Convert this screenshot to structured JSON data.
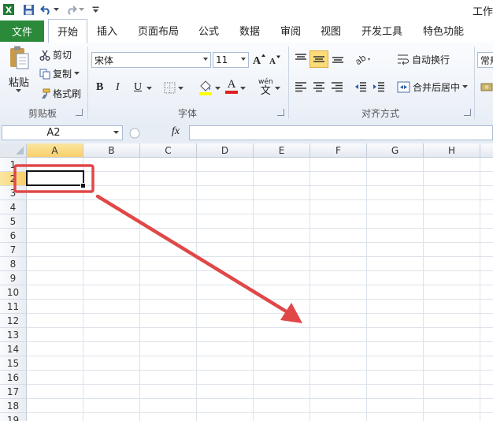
{
  "window": {
    "title": "工作"
  },
  "quick_access": {
    "icons": [
      "excel-logo-icon",
      "save-icon",
      "undo-icon",
      "redo-icon",
      "customize-qat-icon"
    ]
  },
  "tabs": [
    {
      "label": "文件",
      "active": false
    },
    {
      "label": "开始",
      "active": true
    },
    {
      "label": "插入",
      "active": false
    },
    {
      "label": "页面布局",
      "active": false
    },
    {
      "label": "公式",
      "active": false
    },
    {
      "label": "数据",
      "active": false
    },
    {
      "label": "审阅",
      "active": false
    },
    {
      "label": "视图",
      "active": false
    },
    {
      "label": "开发工具",
      "active": false
    },
    {
      "label": "特色功能",
      "active": false
    }
  ],
  "clipboard": {
    "paste": "粘贴",
    "cut": "剪切",
    "copy": "复制",
    "format_painter": "格式刷",
    "group": "剪贴板"
  },
  "font": {
    "name": "宋体",
    "size": "11",
    "bold": "B",
    "italic": "I",
    "underline": "U",
    "font_color_glyph": "A",
    "phonetic_top": "wén",
    "phonetic_bottom": "文",
    "group": "字体"
  },
  "alignment": {
    "wrap_text": "自动换行",
    "merge_center": "合并后居中",
    "group": "对齐方式"
  },
  "number": {
    "format": "常规"
  },
  "formula_bar": {
    "name_box": "A2",
    "fx": "fx",
    "value": ""
  },
  "grid": {
    "columns": [
      "A",
      "B",
      "C",
      "D",
      "E",
      "F",
      "G",
      "H"
    ],
    "rows": [
      "1",
      "2",
      "3",
      "4",
      "5",
      "6",
      "7",
      "8",
      "9",
      "10",
      "11",
      "12",
      "13",
      "14",
      "15",
      "16",
      "17",
      "18",
      "19"
    ],
    "active_cell": "A2"
  },
  "annotation": {
    "highlight_color": "#e04848",
    "arrow_color": "#e04848"
  },
  "colors": {
    "file_tab": "#2a8a3a",
    "selected_header": "#f8cf6a",
    "ribbon_bg": "#e8eef6"
  }
}
